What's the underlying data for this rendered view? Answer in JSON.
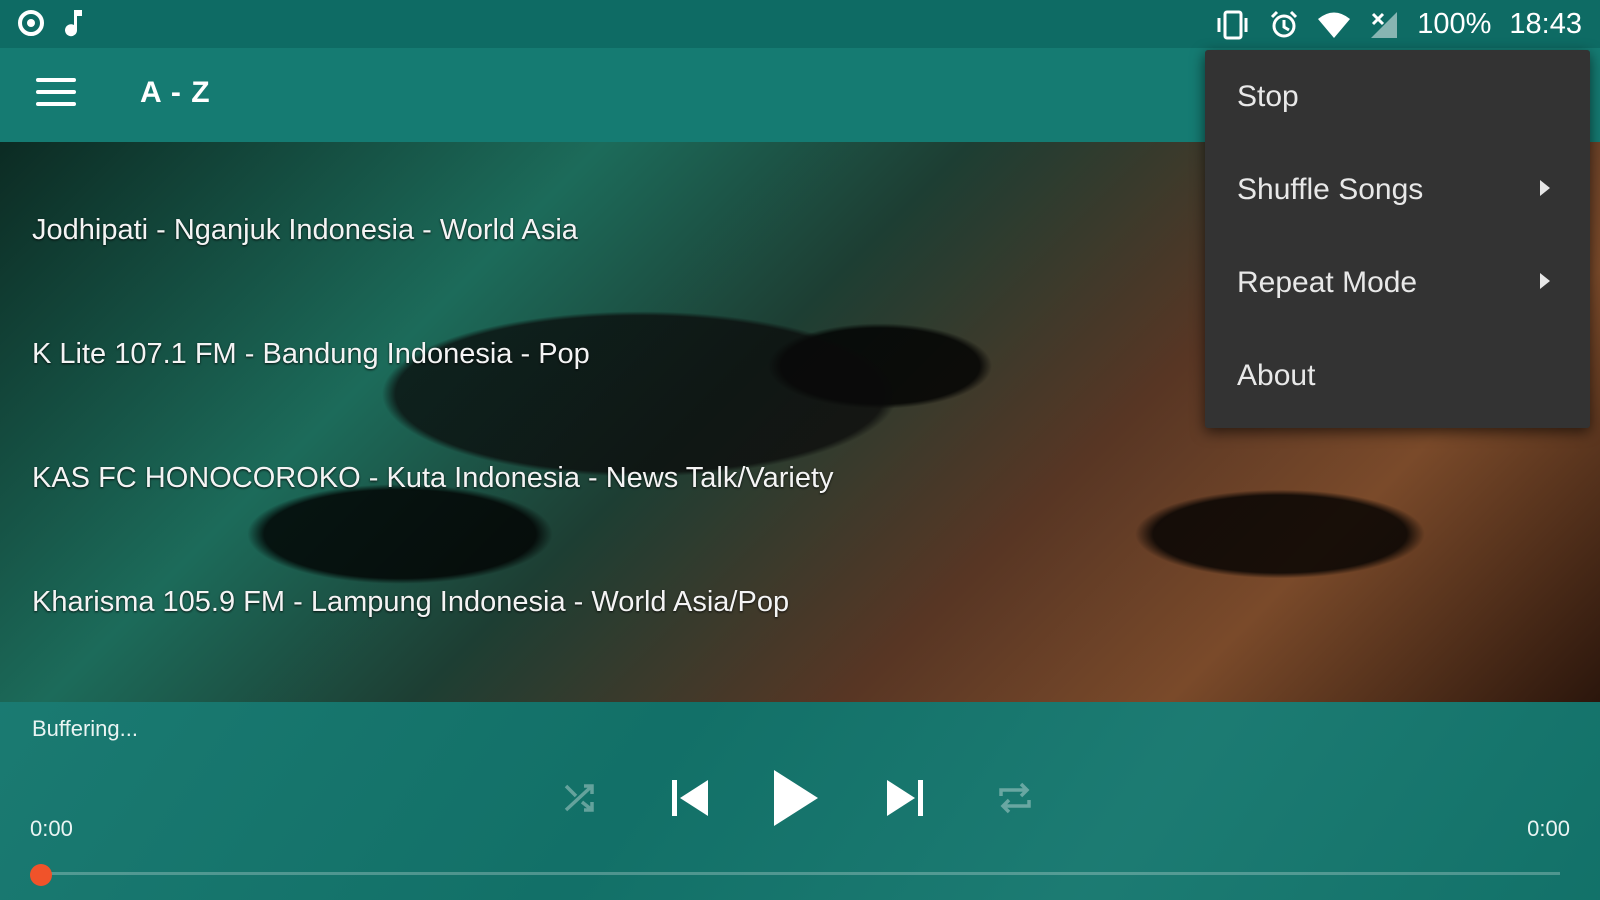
{
  "status_bar": {
    "battery": "100%",
    "time": "18:43",
    "icons": [
      "app-circle-icon",
      "music-note-icon",
      "vibrate-icon",
      "alarm-icon",
      "wifi-icon",
      "no-signal-icon"
    ]
  },
  "toolbar": {
    "title": "A - Z",
    "menu_icon": "hamburger-menu-icon"
  },
  "stations": [
    {
      "label": "Jodhipati - Nganjuk Indonesia - World Asia"
    },
    {
      "label": "K Lite 107.1 FM - Bandung Indonesia - Pop"
    },
    {
      "label": "KAS FC HONOCOROKO - Kuta Indonesia - News Talk/Variety"
    },
    {
      "label": "Kharisma 105.9 FM - Lampung Indonesia - World Asia/Pop"
    }
  ],
  "overflow_menu": {
    "items": [
      {
        "label": "Stop",
        "has_submenu": false
      },
      {
        "label": "Shuffle Songs",
        "has_submenu": true
      },
      {
        "label": "Repeat Mode",
        "has_submenu": true
      },
      {
        "label": "About",
        "has_submenu": false
      }
    ]
  },
  "player": {
    "status": "Buffering...",
    "elapsed": "0:00",
    "duration": "0:00",
    "progress": 0,
    "accent_color": "#f0532a",
    "controls": [
      "shuffle-icon",
      "skip-previous-icon",
      "play-icon",
      "skip-next-icon",
      "repeat-icon"
    ]
  },
  "colors": {
    "status_bar": "#0e6b64",
    "toolbar": "#157b72",
    "player": "#13766d",
    "menu_bg": "#333333"
  }
}
